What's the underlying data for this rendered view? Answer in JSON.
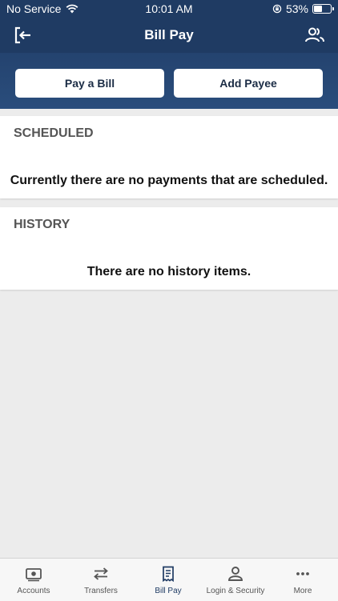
{
  "status_bar": {
    "carrier": "No Service",
    "time": "10:01 AM",
    "battery": "53%",
    "battery_level": 0.53
  },
  "nav": {
    "title": "Bill Pay"
  },
  "actions": {
    "pay_bill": "Pay a Bill",
    "add_payee": "Add Payee"
  },
  "scheduled": {
    "title": "SCHEDULED",
    "message": "Currently there are no payments that are scheduled."
  },
  "history": {
    "title": "HISTORY",
    "message": "There are no history items."
  },
  "tabs": [
    {
      "label": "Accounts",
      "icon": "money-icon"
    },
    {
      "label": "Transfers",
      "icon": "transfer-arrows-icon"
    },
    {
      "label": "Bill Pay",
      "icon": "bill-icon"
    },
    {
      "label": "Login & Security",
      "icon": "person-icon"
    },
    {
      "label": "More",
      "icon": "ellipsis-icon"
    }
  ],
  "colors": {
    "primary": "#1f3b63",
    "background": "#ececec",
    "active_tab": "#1f3b63",
    "inactive_tab": "#555555"
  },
  "active_tab": "Bill Pay"
}
